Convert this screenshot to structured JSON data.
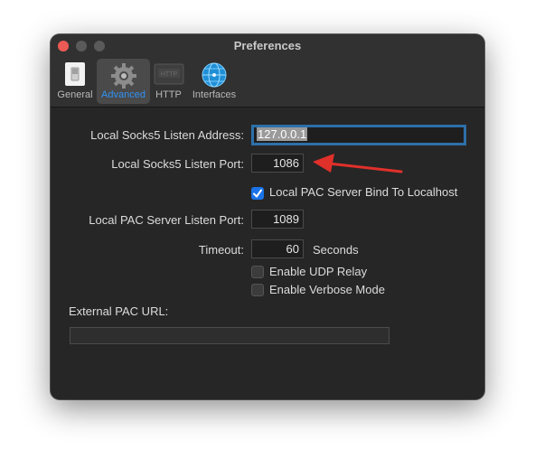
{
  "window": {
    "title": "Preferences"
  },
  "toolbar": {
    "tabs": [
      {
        "label": "General",
        "icon": "switch-icon"
      },
      {
        "label": "Advanced",
        "icon": "gear-icon"
      },
      {
        "label": "HTTP",
        "icon": "http-icon"
      },
      {
        "label": "Interfaces",
        "icon": "globe-icon"
      }
    ],
    "active_tab": "Advanced"
  },
  "form": {
    "socks_address_label": "Local Socks5 Listen Address:",
    "socks_address_value": "127.0.0.1",
    "socks_port_label": "Local Socks5 Listen Port:",
    "socks_port_value": "1086",
    "pac_bind_label": "Local PAC Server Bind To Localhost",
    "pac_bind_checked": true,
    "pac_port_label": "Local PAC Server Listen Port:",
    "pac_port_value": "1089",
    "timeout_label": "Timeout:",
    "timeout_value": "60",
    "timeout_unit": "Seconds",
    "udp_relay_label": "Enable UDP Relay",
    "udp_relay_checked": false,
    "verbose_label": "Enable Verbose Mode",
    "verbose_checked": false,
    "external_pac_label": "External PAC URL:",
    "external_pac_value": ""
  },
  "colors": {
    "accent": "#1a73e8",
    "arrow": "#e0302a",
    "close": "#ec5a55"
  }
}
